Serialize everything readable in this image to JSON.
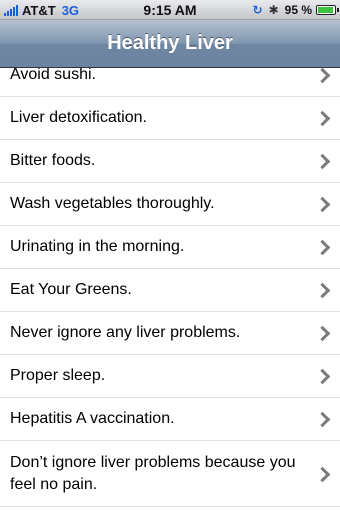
{
  "status_bar": {
    "carrier": "AT&T",
    "network": "3G",
    "time": "9:15 AM",
    "battery": "95 %",
    "battery_level": 0.95,
    "icons": [
      "signal-icon",
      "lock-rotation-icon",
      "bluetooth-icon",
      "battery-icon"
    ]
  },
  "nav": {
    "title": "Healthy Liver"
  },
  "list": {
    "items": [
      {
        "label": "Avoid sushi."
      },
      {
        "label": "Liver detoxification."
      },
      {
        "label": "Bitter foods."
      },
      {
        "label": "Wash vegetables thoroughly."
      },
      {
        "label": "Urinating in the morning."
      },
      {
        "label": "Eat Your Greens."
      },
      {
        "label": "Never ignore any liver problems."
      },
      {
        "label": "Proper sleep."
      },
      {
        "label": "Hepatitis A vaccination."
      },
      {
        "label": "Don’t ignore liver problems because you feel no pain."
      }
    ]
  },
  "colors": {
    "nav_gradient_top": "#b3c1d2",
    "nav_gradient_bottom": "#6c84a1",
    "network_blue": "#1b5fd6",
    "battery_green": "#3cc23c"
  }
}
